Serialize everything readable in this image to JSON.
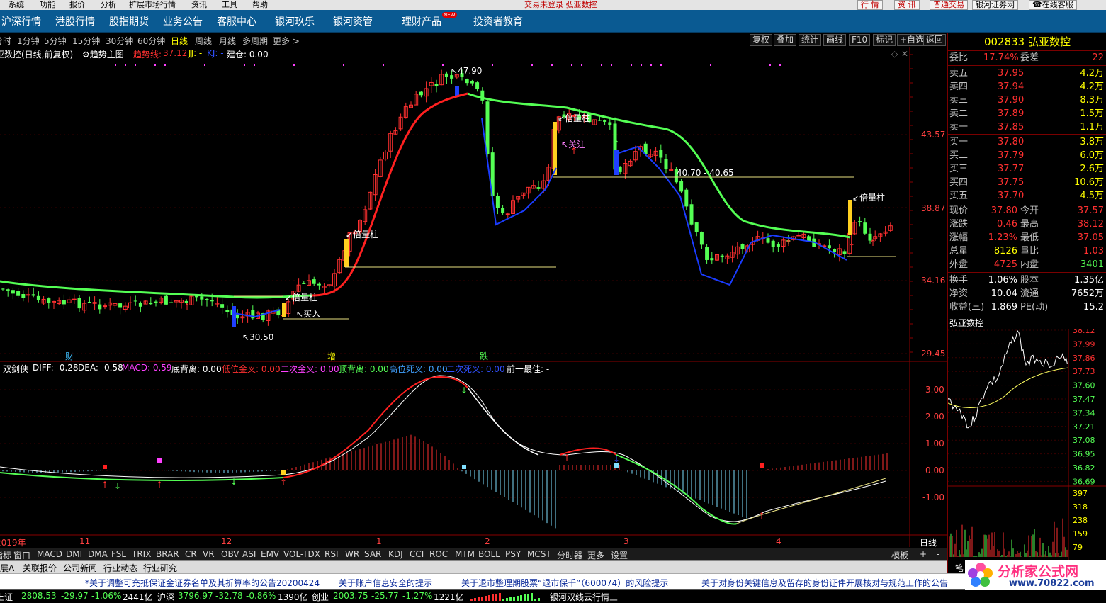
{
  "menubar": {
    "items": [
      "系统",
      "功能",
      "报价",
      "分析",
      "扩展市场行情",
      "资讯",
      "工具",
      "帮助"
    ],
    "notice": "交易未登录 弘亚数控",
    "right_buttons": [
      "行 情",
      "资 讯",
      "普通交易",
      "银河证券网",
      "在线客服"
    ]
  },
  "navbar": {
    "items": [
      "沪深行情",
      "港股行情",
      "股指期货",
      "业务公告",
      "客服中心",
      "银河玖乐",
      "银河资管",
      "理财产品",
      "投资者教育"
    ],
    "new_badge": "NEW"
  },
  "periods": {
    "items": [
      "分时",
      "1分钟",
      "5分钟",
      "15分钟",
      "30分钟",
      "60分钟",
      "日线",
      "周线",
      "月线",
      "多周期",
      "更多 >"
    ],
    "active": "日线",
    "right_buttons": [
      "复权",
      "叠加",
      "统计",
      "画线",
      "F10",
      "标记",
      "+自选",
      "返回"
    ]
  },
  "main_chart": {
    "title": "亚数控(日线,前复权)",
    "subtitle": "趋势主图",
    "indicator_name": "趋势线:",
    "indicator_value": "37.12",
    "jj_label": "JJ: -",
    "kj_label": "KJ: -",
    "build_label": "建仓: 0.00",
    "y_ticks": [
      "43.57",
      "38.87",
      "34.16",
      "29.45"
    ],
    "annotations": {
      "high": "47.90",
      "low": "30.50",
      "support": "40.70 - 40.65",
      "vol_labels": [
        "倍量柱",
        "倍量柱",
        "倍量柱",
        "倍量柱"
      ],
      "buy": "买入",
      "watch": "关注"
    },
    "markers": [
      "财",
      "增",
      "跌"
    ],
    "colors": {
      "up": "#ff3030",
      "down": "#54ff54",
      "line_up": "#ff2020",
      "line_down": "#1a3cff",
      "line_flat": "#54ff54"
    }
  },
  "macd": {
    "labels": {
      "name": "双剑侠",
      "diff": "DIFF: -0.28",
      "dea": "DEA: -0.58",
      "macd": "MACD: 0.59",
      "bottom_div": "底背离: 0.00",
      "low_gold": "低位金叉: 0.00",
      "second_gold": "二次金叉: 0.00",
      "top_div": "顶背离: 0.00",
      "high_dead": "高位死叉: 0.00",
      "second_dead": "二次死叉: 0.00",
      "prev_best": "前一最佳: -"
    },
    "y_ticks": [
      "3.00",
      "2.00",
      "1.00",
      "0.00",
      "-1.00"
    ]
  },
  "x_axis": {
    "labels": [
      "2019年",
      "11",
      "12",
      "1",
      "2",
      "3",
      "4"
    ],
    "period": "日线"
  },
  "indicator_tabs": [
    "指标",
    "窗口",
    "MACD",
    "DMI",
    "DMA",
    "FSL",
    "TRIX",
    "BRAR",
    "CR",
    "VR",
    "OBV",
    "ASI",
    "EMV",
    "VOL-TDX",
    "RSI",
    "WR",
    "SAR",
    "KDJ",
    "CCI",
    "ROC",
    "MTM",
    "BOLL",
    "PSY",
    "MCST",
    "分时器",
    "更多",
    "设置"
  ],
  "indicator_tab_right": [
    "模板",
    "+",
    "-"
  ],
  "bottom_tabs": [
    "扩展Λ",
    "关联报价",
    "公司新闻",
    "行业动态",
    "行业研究"
  ],
  "ticker": [
    "*关于调整可充抵保证金证券名单及其折算率的公告20200424",
    "关于账户信息安全的提示",
    "关于退市整理期股票“退市保千”（600074）的风险提示",
    "关于对身份关键信息及留存的身份证件开展核对与规范工作的公告"
  ],
  "statusbar": {
    "sh": {
      "label": "上证",
      "value": "2808.53",
      "change": "-29.97",
      "pct": "-1.06%",
      "amount": "2441亿"
    },
    "hs": {
      "label": "沪深",
      "value": "3796.97",
      "change": "-32.78",
      "pct": "-0.86%",
      "amount": "1390亿"
    },
    "cy": {
      "label": "创业",
      "value": "2003.75",
      "change": "-25.77",
      "pct": "-1.27%",
      "amount": "1221亿"
    },
    "connection": "银河双线云行情三"
  },
  "quote": {
    "code": "002833",
    "name": "弘亚数控",
    "ratio": {
      "l1": "委比",
      "v1": "17.74%",
      "l2": "委差",
      "v2": "22"
    },
    "asks": [
      {
        "label": "卖五",
        "price": "37.95",
        "vol": "4.2万"
      },
      {
        "label": "卖四",
        "price": "37.94",
        "vol": "4.2万"
      },
      {
        "label": "卖三",
        "price": "37.90",
        "vol": "8.3万"
      },
      {
        "label": "卖二",
        "price": "37.89",
        "vol": "1.5万"
      },
      {
        "label": "卖一",
        "price": "37.85",
        "vol": "1.1万"
      }
    ],
    "bids": [
      {
        "label": "买一",
        "price": "37.80",
        "vol": "3.8万"
      },
      {
        "label": "买二",
        "price": "37.79",
        "vol": "6.0万"
      },
      {
        "label": "买三",
        "price": "37.77",
        "vol": "2.6万"
      },
      {
        "label": "买四",
        "price": "37.75",
        "vol": "10.6万"
      },
      {
        "label": "买五",
        "price": "37.70",
        "vol": "4.5万"
      }
    ],
    "stats": [
      {
        "l1": "现价",
        "v1": "37.80",
        "l2": "今开",
        "v2": "37.57"
      },
      {
        "l1": "涨跌",
        "v1": "0.46",
        "l2": "最高",
        "v2": "38.12"
      },
      {
        "l1": "涨幅",
        "v1": "1.23%",
        "l2": "最低",
        "v2": "37.05"
      },
      {
        "l1": "总量",
        "v1": "8126",
        "l2": "量比",
        "v2": "1.03"
      },
      {
        "l1": "外盘",
        "v1": "4725",
        "l2": "内盘",
        "v2": "3401"
      }
    ],
    "stats2": [
      {
        "l1": "换手",
        "v1": "1.06%",
        "l2": "股本",
        "v2": "1.35亿"
      },
      {
        "l1": "净资",
        "v1": "10.04",
        "l2": "流通",
        "v2": "7652万"
      },
      {
        "l1": "收益(三)",
        "v1": "1.869",
        "l2": "PE(动)",
        "v2": "15.2"
      }
    ],
    "mini_title": "弘亚数控",
    "mini_price_ticks": [
      "38.12",
      "37.99",
      "37.86",
      "37.73",
      "37.60",
      "37.47",
      "37.34",
      "37.21",
      "37.08",
      "36.95",
      "36.82",
      "36.69"
    ],
    "mini_vol_ticks": [
      "397",
      "318",
      "238",
      "159",
      "79"
    ],
    "bottom_label": "笔"
  },
  "watermark": {
    "text": "分析家公式网",
    "url": "www.70822.com"
  }
}
